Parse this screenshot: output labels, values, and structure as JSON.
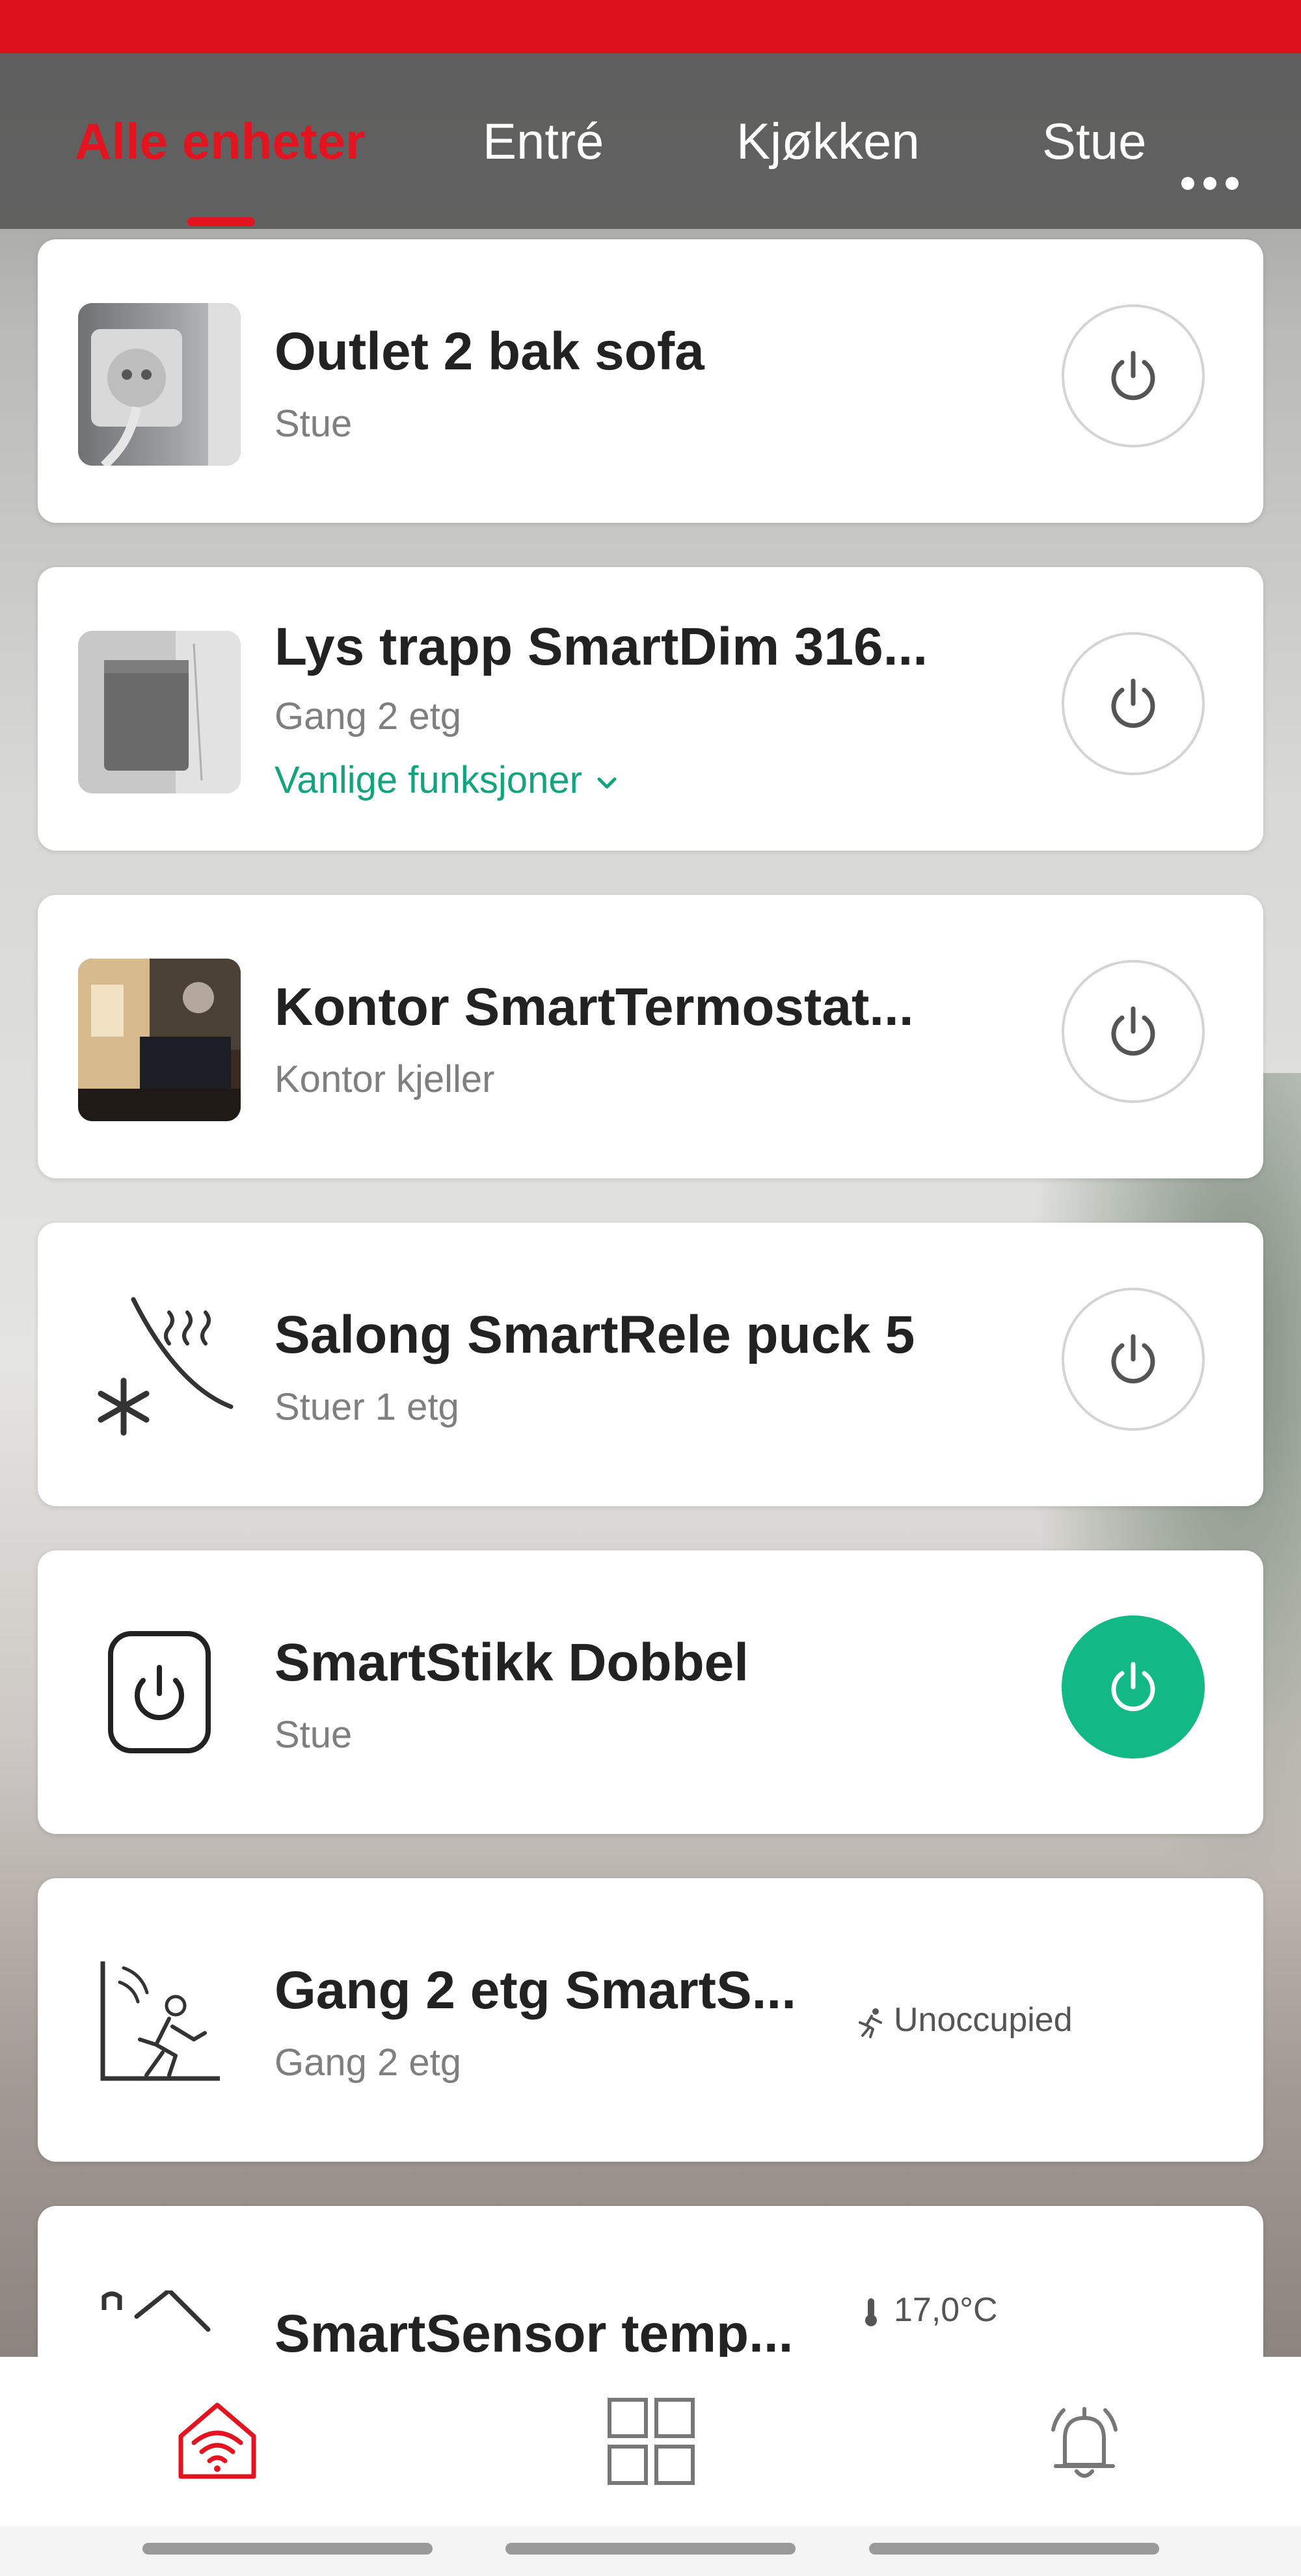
{
  "tabs": [
    {
      "label": "Alle enheter",
      "active": true
    },
    {
      "label": "Entré",
      "active": false
    },
    {
      "label": "Kjøkken",
      "active": false
    },
    {
      "label": "Stue",
      "active": false
    }
  ],
  "devices": [
    {
      "title": "Outlet 2 bak sofa",
      "room": "Stue",
      "icon": "outlet-photo",
      "power": "off"
    },
    {
      "title": "Lys trapp SmartDim 316...",
      "room": "Gang 2 etg",
      "functions_link": "Vanlige funksjoner",
      "icon": "dimmer-photo",
      "power": "off"
    },
    {
      "title": "Kontor SmartTermostat...",
      "room": "Kontor kjeller",
      "icon": "office-photo",
      "power": "off"
    },
    {
      "title": "Salong SmartRele puck 5",
      "room": "Stuer 1 etg",
      "icon": "heat-cool-icon",
      "power": "off"
    },
    {
      "title": "SmartStikk Dobbel",
      "room": "Stue",
      "icon": "plug-icon",
      "power": "on"
    },
    {
      "title": "Gang 2 etg SmartS...",
      "room": "Gang 2 etg",
      "icon": "motion-sensor-icon",
      "status": "Unoccupied"
    },
    {
      "title": "SmartSensor temp...",
      "room": "",
      "icon": "temperature-sensor-icon",
      "status": "17,0°C"
    }
  ],
  "bottom_nav": [
    {
      "name": "home",
      "icon": "home-wifi-icon",
      "active": true
    },
    {
      "name": "dashboard",
      "icon": "grid-icon",
      "active": false
    },
    {
      "name": "alarm",
      "icon": "bell-icon",
      "active": false
    }
  ],
  "colors": {
    "accent_red": "#e3141f",
    "status_bar_red": "#dc0f1d",
    "power_on_green": "#12b886",
    "link_green": "#14a37f"
  }
}
